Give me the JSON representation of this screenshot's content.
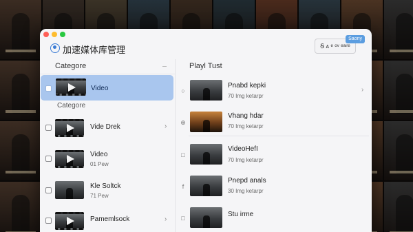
{
  "app": {
    "title": "加速媒体库管理",
    "sync_badge": "Saony",
    "sync_button": "Ꞩ ᴀ ᵉ ᵒᵛ ᵉᵃᶦʳᵉ"
  },
  "left_panel": {
    "header": "Categore",
    "subheading": "Categore",
    "selected_item": {
      "label": "Video",
      "icon": "play-thumbnail"
    },
    "items": [
      {
        "name": "Vide Drek",
        "sub": "",
        "icon": "square-checkbox",
        "has_chevron": true
      },
      {
        "name": "Video",
        "sub": "01 Pew",
        "icon": "folder-icon",
        "has_chevron": false
      },
      {
        "name": "Kle Soltck",
        "sub": "71 Pew",
        "icon": "book-icon",
        "has_chevron": false
      },
      {
        "name": "Pamemlsock",
        "sub": "",
        "icon": "square-checkbox",
        "has_chevron": true
      }
    ]
  },
  "right_panel": {
    "header": "Playl Tust",
    "items": [
      {
        "name": "Pnabd kepki",
        "sub": "70 Img ketarpr",
        "icon": "search-icon",
        "has_chevron": true
      },
      {
        "name": "Vhang hdar",
        "sub": "70 Img ketarpr",
        "icon": "plus-circle-icon",
        "has_chevron": false
      },
      {
        "name": "VideoHefI",
        "sub": "70 Img ketarpr",
        "icon": "square-icon",
        "has_chevron": false
      },
      {
        "name": "Pnepd anals",
        "sub": "30 Img ketarpr",
        "icon": "facebook-icon",
        "has_chevron": false
      },
      {
        "name": "Stu irme",
        "sub": "",
        "icon": "square-icon",
        "has_chevron": false
      }
    ]
  },
  "colors": {
    "selection": "#a9c6ee",
    "accent": "#3a7bd5",
    "window_bg": "#f5f5f7"
  }
}
